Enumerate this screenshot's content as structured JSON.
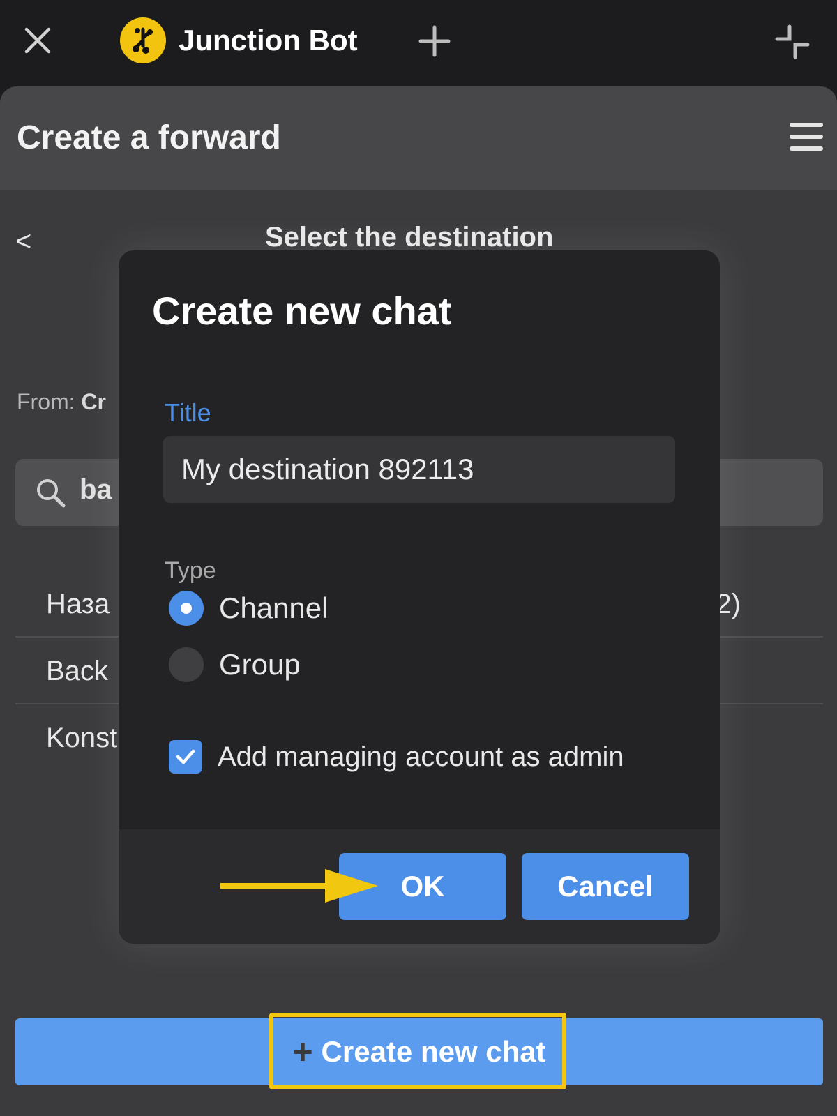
{
  "topbar": {
    "title": "Junction Bot",
    "close_icon": "close-icon",
    "new_tab_icon": "plus-icon",
    "minimize_icon": "minimize-icon"
  },
  "header": {
    "title": "Create a forward",
    "menu_icon": "hamburger-menu-icon"
  },
  "main": {
    "back_label": "<",
    "subtitle": "Select the destination",
    "from_label": "From:",
    "from_value": "Cr",
    "search_value": "ba",
    "list": [
      {
        "label": "Наза",
        "extra": "2)"
      },
      {
        "label": "Back",
        "extra": ""
      },
      {
        "label": "Konst",
        "extra": ""
      }
    ],
    "create_button": {
      "plus": "+",
      "label": "Create new chat"
    }
  },
  "dialog": {
    "title": "Create new chat",
    "title_field_label": "Title",
    "title_field_value": "My destination 892113",
    "type_label": "Type",
    "options": [
      {
        "label": "Channel",
        "selected": true
      },
      {
        "label": "Group",
        "selected": false
      }
    ],
    "admin_checkbox": {
      "label": "Add managing account as admin",
      "checked": true
    },
    "ok_label": "OK",
    "cancel_label": "Cancel"
  },
  "colors": {
    "accent": "#4b8fe8",
    "highlight": "#f2c70f",
    "logo": "#f2c40f"
  }
}
